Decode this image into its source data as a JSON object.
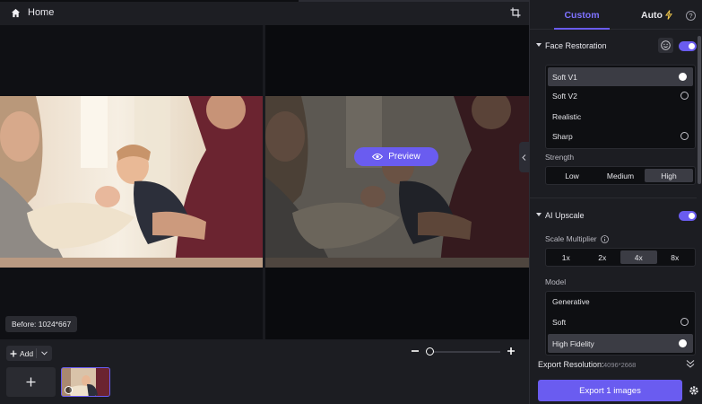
{
  "topbar": {
    "home_label": "Home"
  },
  "canvas": {
    "before_badge": "Before: 1024*667",
    "preview_label": "Preview"
  },
  "filmstrip": {
    "add_label": "Add",
    "add_tile_symbol": "+"
  },
  "panel": {
    "tabs": {
      "custom": "Custom",
      "auto": "Auto"
    },
    "help_symbol": "?",
    "face_restoration": {
      "title": "Face Restoration",
      "enabled": true,
      "models": [
        {
          "label": "Soft V1",
          "state": "selected"
        },
        {
          "label": "Soft V2",
          "state": "download"
        },
        {
          "label": "Realistic",
          "state": "none"
        },
        {
          "label": "Sharp",
          "state": "download"
        }
      ],
      "strength_label": "Strength",
      "strength_options": [
        "Low",
        "Medium",
        "High"
      ],
      "strength_selected": "High"
    },
    "ai_upscale": {
      "title": "AI Upscale",
      "enabled": true,
      "scale_label": "Scale Multiplier",
      "scale_options": [
        "1x",
        "2x",
        "4x",
        "8x"
      ],
      "scale_selected": "4x",
      "model_label": "Model",
      "models": [
        {
          "label": "Generative",
          "state": "none"
        },
        {
          "label": "Soft",
          "state": "download"
        },
        {
          "label": "High Fidelity",
          "state": "selected"
        }
      ]
    },
    "export_resolution_label": "Export Resolution:",
    "export_resolution_value": "4096*2668",
    "export_button": "Export 1 images"
  },
  "colors": {
    "accent": "#6a5cf0",
    "panel_bg": "#1c1d22",
    "canvas_bg": "#0f1014"
  },
  "icons": [
    "home-icon",
    "crop-icon",
    "eye-icon",
    "chevron-left-icon",
    "plus-icon",
    "chevron-down-icon",
    "minus-icon",
    "lightning-icon",
    "help-icon",
    "face-icon",
    "check-icon",
    "download-icon",
    "info-icon",
    "double-chevron-down-icon",
    "gear-icon",
    "clock-icon"
  ]
}
